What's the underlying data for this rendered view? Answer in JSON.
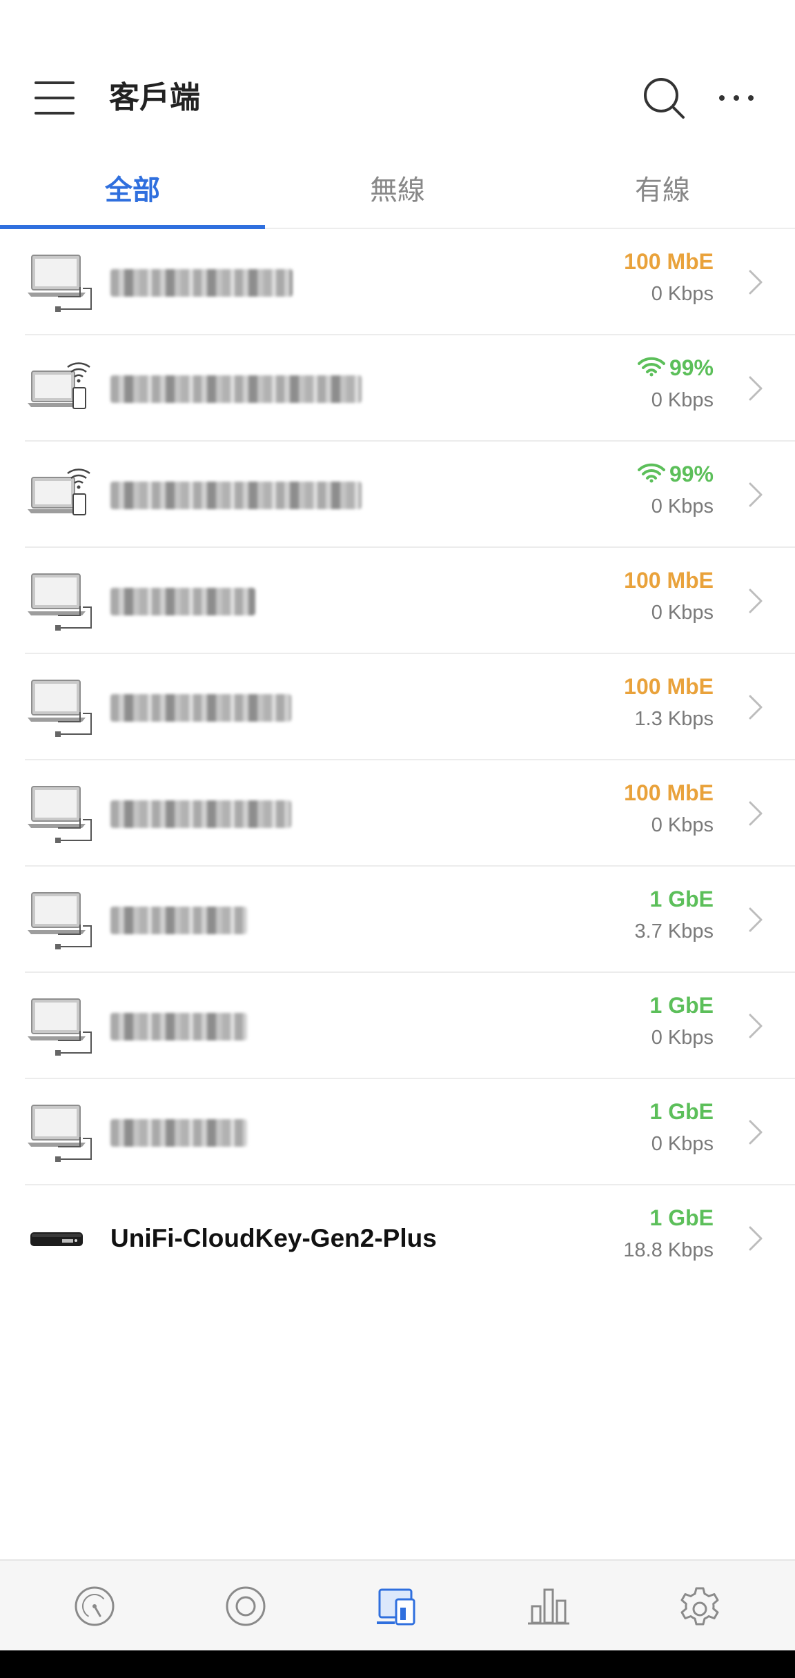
{
  "header": {
    "title": "客戶端",
    "menu_icon": "hamburger-icon",
    "search_icon": "search-icon",
    "more_icon": "more-horizontal-icon"
  },
  "tabs": [
    {
      "label": "全部",
      "active": true
    },
    {
      "label": "無線",
      "active": false
    },
    {
      "label": "有線",
      "active": false
    }
  ],
  "colors": {
    "accent": "#2f6fde",
    "wired_100m": "#e9a23b",
    "wired_1g_and_wifi": "#5cbf5a",
    "secondary_text": "#7a7a7a"
  },
  "clients": [
    {
      "icon": "wired-laptop-icon",
      "name": "",
      "name_blurred": true,
      "speed": "100 MbE",
      "speed_color": "orange",
      "rate": "0 Kbps"
    },
    {
      "icon": "wireless-laptop-icon",
      "name": "",
      "name_blurred": true,
      "speed": "99%",
      "speed_color": "green",
      "signal_icon": "wifi-signal-icon",
      "rate": "0 Kbps"
    },
    {
      "icon": "wireless-laptop-icon",
      "name": "",
      "name_blurred": true,
      "speed": "99%",
      "speed_color": "green",
      "signal_icon": "wifi-signal-icon",
      "rate": "0 Kbps"
    },
    {
      "icon": "wired-laptop-icon",
      "name": "",
      "name_blurred": true,
      "speed": "100 MbE",
      "speed_color": "orange",
      "rate": "0 Kbps"
    },
    {
      "icon": "wired-laptop-icon",
      "name": "",
      "name_blurred": true,
      "speed": "100 MbE",
      "speed_color": "orange",
      "rate": "1.3 Kbps"
    },
    {
      "icon": "wired-laptop-icon",
      "name": "",
      "name_blurred": true,
      "speed": "100 MbE",
      "speed_color": "orange",
      "rate": "0 Kbps"
    },
    {
      "icon": "wired-laptop-icon",
      "name": "",
      "name_blurred": true,
      "speed": "1 GbE",
      "speed_color": "green",
      "rate": "3.7 Kbps"
    },
    {
      "icon": "wired-laptop-icon",
      "name": "",
      "name_blurred": true,
      "speed": "1 GbE",
      "speed_color": "green",
      "rate": "0 Kbps"
    },
    {
      "icon": "wired-laptop-icon",
      "name": "",
      "name_blurred": true,
      "speed": "1 GbE",
      "speed_color": "green",
      "rate": "0 Kbps"
    },
    {
      "icon": "cloudkey-device-icon",
      "name": "UniFi-CloudKey-Gen2-Plus",
      "name_blurred": false,
      "speed": "1 GbE",
      "speed_color": "green",
      "rate": "18.8 Kbps"
    }
  ],
  "bottom_nav": [
    {
      "icon": "dashboard-gauge-icon",
      "active": false
    },
    {
      "icon": "devices-target-icon",
      "active": false
    },
    {
      "icon": "clients-icon",
      "active": true
    },
    {
      "icon": "statistics-bar-icon",
      "active": false
    },
    {
      "icon": "settings-gear-icon",
      "active": false
    }
  ]
}
